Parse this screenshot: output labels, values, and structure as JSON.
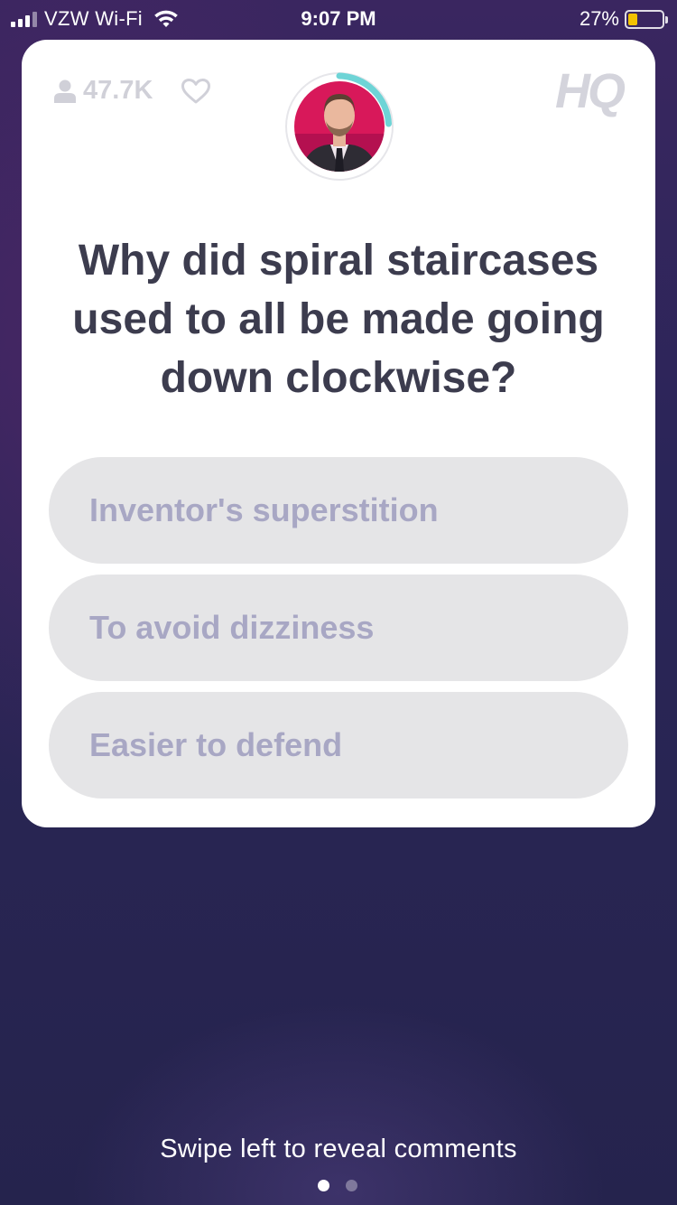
{
  "status_bar": {
    "carrier": "VZW Wi-Fi",
    "time": "9:07 PM",
    "battery_percent": "27%",
    "battery_level": 0.27,
    "battery_color": "#f2c200"
  },
  "header": {
    "viewer_count": "47.7K",
    "logo": "HQ",
    "icons": [
      "person-icon",
      "heart-icon",
      "wifi-icon"
    ],
    "timer_color": "#6ed4d6"
  },
  "question": {
    "text": "Why did spiral staircases used to all be made going down clockwise?"
  },
  "answers": [
    {
      "label": "Inventor's superstition"
    },
    {
      "label": "To avoid dizziness"
    },
    {
      "label": "Easier to defend"
    }
  ],
  "footer": {
    "hint": "Swipe left to reveal comments",
    "page_count": 2,
    "active_page": 1
  },
  "colors": {
    "card": "#ffffff",
    "answer_bg": "#e5e5e7",
    "answer_text": "#a8a7c4",
    "question_text": "#3c3c4e",
    "background": "#2a2558"
  }
}
